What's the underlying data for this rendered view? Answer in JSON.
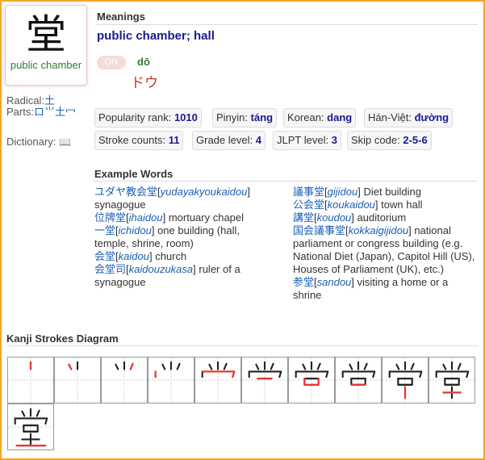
{
  "kanji": {
    "character": "堂",
    "short_meaning": "public chamber"
  },
  "radical": {
    "label": "Radical:",
    "value": "土"
  },
  "parts": {
    "label": "Parts:",
    "value": "ロ⺌土冖"
  },
  "dictionary": {
    "label": "Dictionary:",
    "value": "📖"
  },
  "meanings": {
    "title": "Meanings",
    "text": "public chamber; hall"
  },
  "reading": {
    "on_badge": "ON",
    "romaji": "dō",
    "kana": "ドウ"
  },
  "stats_row1": [
    {
      "label": "Popularity rank:",
      "value": "1010"
    },
    {
      "label": "Pinyin:",
      "value": "táng"
    },
    {
      "label": "Korean:",
      "value": "dang"
    },
    {
      "label": "Hán-Việt:",
      "value": "đường"
    }
  ],
  "stats_row2": [
    {
      "label": "Stroke counts:",
      "value": "11"
    },
    {
      "label": "Grade level:",
      "value": "4"
    },
    {
      "label": "JLPT level:",
      "value": "3"
    },
    {
      "label": "Skip code:",
      "value": "2-5-6"
    }
  ],
  "examples": {
    "title": "Example Words",
    "left": [
      {
        "word": "ユダヤ教会堂",
        "romaji": "yudayakyoukaidou",
        "meaning": "synagogue"
      },
      {
        "word": "位牌堂",
        "romaji": "ihaidou",
        "meaning": "mortuary chapel"
      },
      {
        "word": "一堂",
        "romaji": "ichidou",
        "meaning": "one building (hall, temple, shrine, room)"
      },
      {
        "word": "会堂",
        "romaji": "kaidou",
        "meaning": "church"
      },
      {
        "word": "会堂司",
        "romaji": "kaidouzukasa",
        "meaning": "ruler of a synagogue"
      }
    ],
    "right": [
      {
        "word": "議事堂",
        "romaji": "gijidou",
        "meaning": "Diet building"
      },
      {
        "word": "公会堂",
        "romaji": "koukaidou",
        "meaning": "town hall"
      },
      {
        "word": "講堂",
        "romaji": "koudou",
        "meaning": "auditorium"
      },
      {
        "word": "国会議事堂",
        "romaji": "kokkaigijidou",
        "meaning": "national parliament or congress building (e.g. National Diet (Japan), Capitol Hill (US), Houses of Parliament (UK), etc.)"
      },
      {
        "word": "参堂",
        "romaji": "sandou",
        "meaning": "visiting a home or a shrine"
      }
    ]
  },
  "strokes": {
    "title": "Kanji Strokes Diagram",
    "count": 11
  },
  "colors": {
    "frame": "#f5a623",
    "stroke_done": "#222222",
    "stroke_current": "#e53935"
  }
}
